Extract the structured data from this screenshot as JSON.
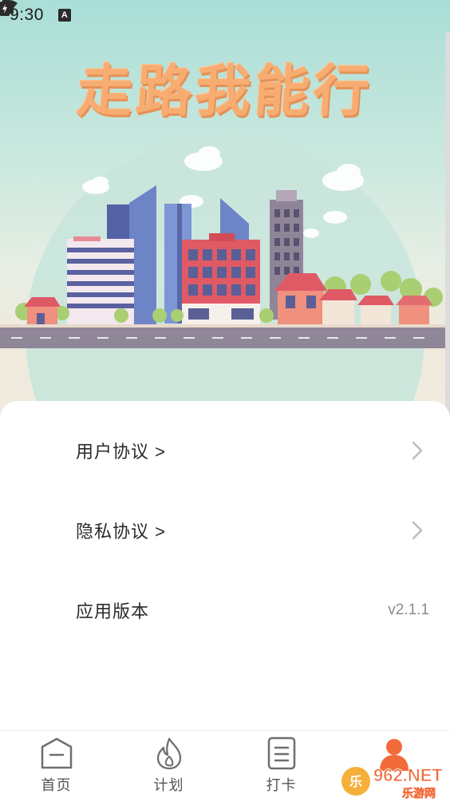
{
  "status_bar": {
    "time": "9:30",
    "notification_icon": "A"
  },
  "hero": {
    "title": "走路我能行"
  },
  "menu": {
    "user_agreement": "用户协议 >",
    "privacy_policy": "隐私协议 >",
    "app_version_label": "应用版本",
    "app_version_value": "v2.1.1"
  },
  "tabbar": {
    "tabs": [
      {
        "label": "首页",
        "icon": "home-icon"
      },
      {
        "label": "计划",
        "icon": "flame-icon"
      },
      {
        "label": "打卡",
        "icon": "checklist-icon"
      },
      {
        "label": "",
        "icon": "profile-icon"
      }
    ]
  },
  "watermark": {
    "text": "962.NET",
    "subtext": "乐游网"
  },
  "colors": {
    "title": "#f7ad72",
    "accent": "#f26b3a",
    "chevron": "#bdbdbd"
  }
}
